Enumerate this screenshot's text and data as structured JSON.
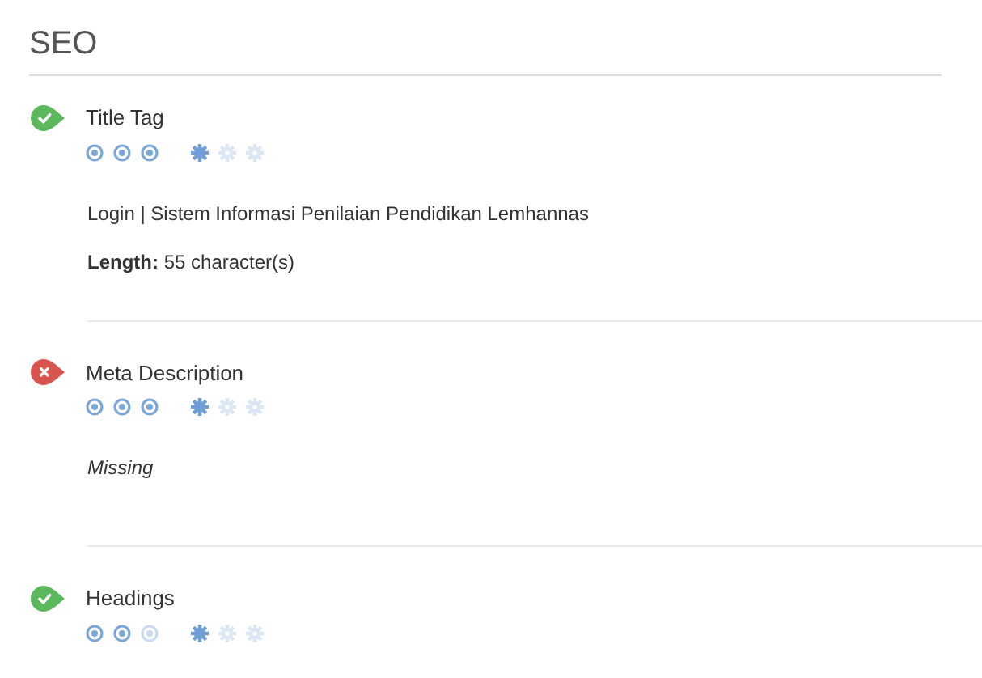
{
  "heading": "SEO",
  "checks": [
    {
      "title": "Title Tag",
      "passed": true,
      "importance": {
        "stars": 3
      },
      "difficulty": {
        "stars": 1
      },
      "details": [
        {
          "kind": "text",
          "text": "Login | Sistem Informasi Penilaian Pendidikan Lemhannas"
        },
        {
          "kind": "text",
          "text": "**Length:** 55 character(s)"
        }
      ]
    },
    {
      "title": "Meta Description",
      "passed": false,
      "importance": {
        "stars": 3
      },
      "difficulty": {
        "stars": 1
      },
      "details": [
        {
          "kind": "note",
          "text": "Missing"
        }
      ]
    },
    {
      "title": "Headings",
      "passed": true,
      "importance": {
        "stars": 2
      },
      "difficulty": {
        "stars": 1
      }
    }
  ]
}
